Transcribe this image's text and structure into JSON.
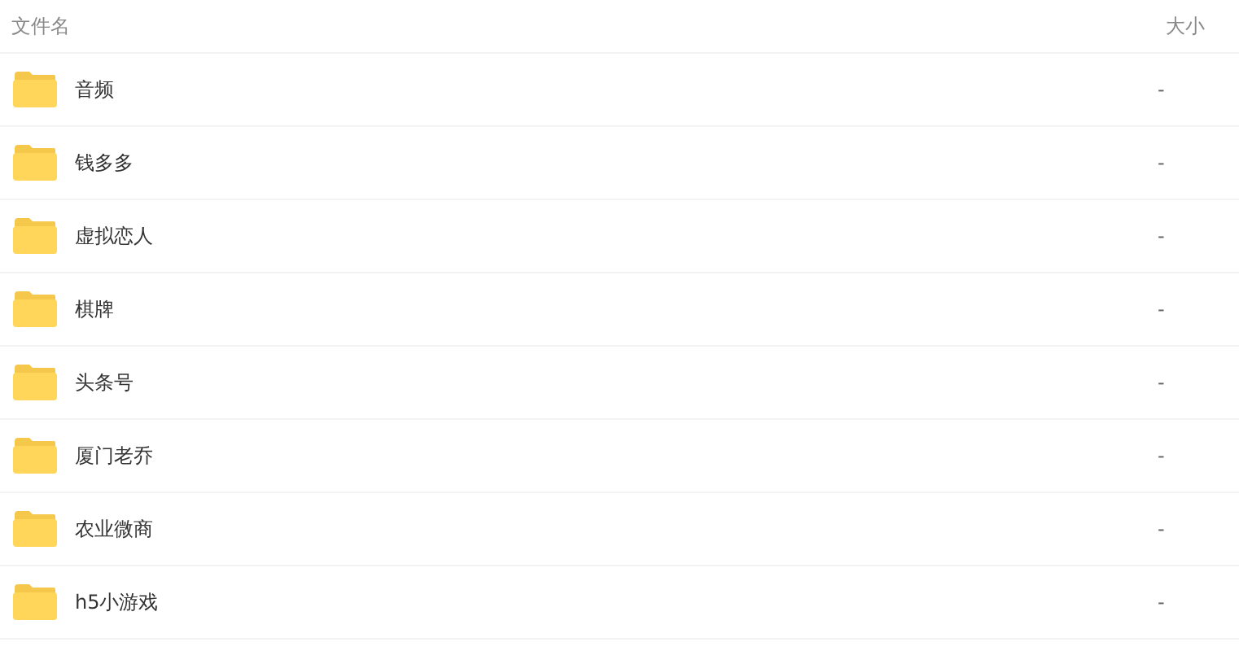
{
  "table": {
    "columns": [
      "文件名",
      "大小"
    ],
    "rows": [
      {
        "name": "音频",
        "size": "-"
      },
      {
        "name": "钱多多",
        "size": "-"
      },
      {
        "name": "虚拟恋人",
        "size": "-"
      },
      {
        "name": "棋牌",
        "size": "-"
      },
      {
        "name": "头条号",
        "size": "-"
      },
      {
        "name": "厦门老乔",
        "size": "-"
      },
      {
        "name": "农业微商",
        "size": "-"
      },
      {
        "name": "h5小游戏",
        "size": "-"
      }
    ]
  }
}
